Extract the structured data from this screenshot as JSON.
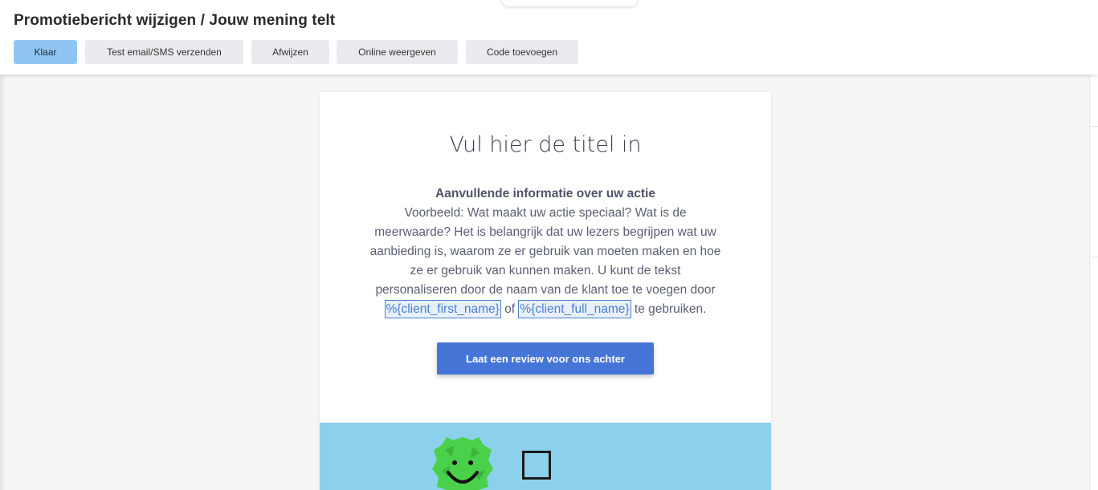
{
  "header": {
    "title": "Promotiebericht wijzigen / Jouw mening telt",
    "buttons": {
      "done": "Klaar",
      "test_send": "Test email/SMS verzenden",
      "reject": "Afwijzen",
      "view_online": "Online weergeven",
      "add_code": "Code toevoegen"
    }
  },
  "email": {
    "headline": "Vul hier de titel in",
    "lead": "Aanvullende informatie over uw actie",
    "body": "Voorbeeld: Wat maakt uw actie speciaal? Wat is de meerwaarde? Het is belangrijk dat uw lezers begrijpen wat uw aanbieding is, waarom ze er gebruik van moeten maken en hoe ze er gebruik van kunnen maken. U kunt de tekst personaliseren door de naam van de klant toe te voegen door",
    "var_first_name": "%{client_first_name}",
    "connector": "of",
    "var_full_name": "%{client_full_name}",
    "tail": "te gebruiken.",
    "cta_label": "Laat een review voor ons achter"
  },
  "colors": {
    "primary_button": "#90c5f3",
    "cta": "#4575d7",
    "image_background": "#8cd1ec",
    "smiley": "#4ad04a"
  },
  "icons": {
    "smiley": "smiley-face-icon",
    "checkbox": "empty-checkbox-icon"
  }
}
